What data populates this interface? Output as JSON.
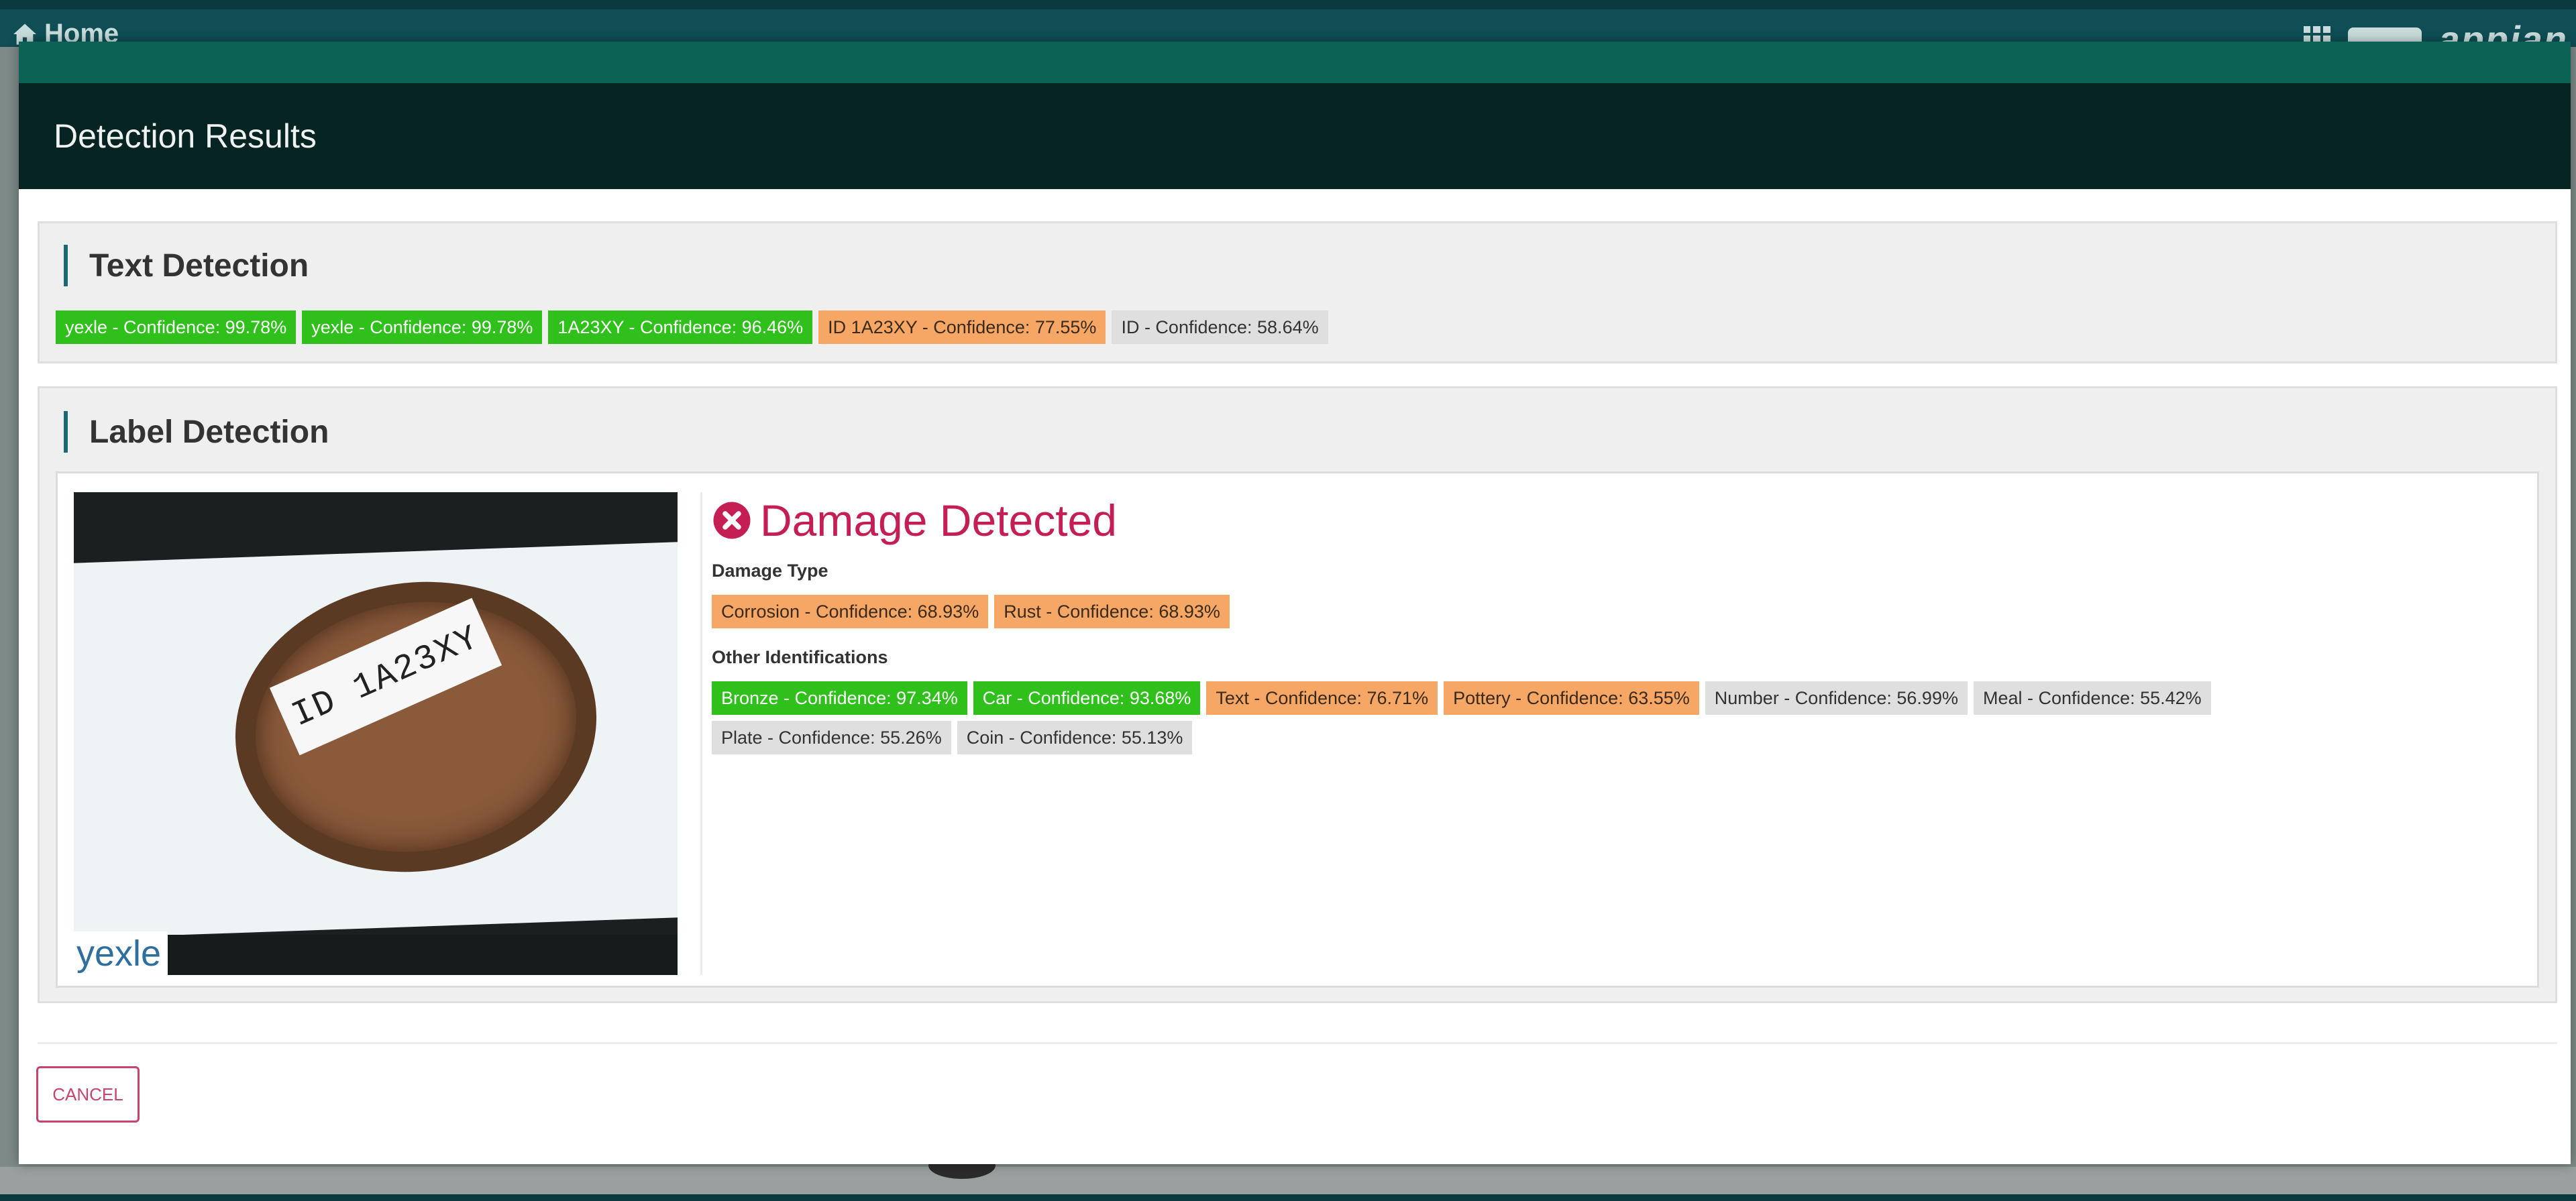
{
  "app": {
    "home_label": "Home",
    "brand": "appian"
  },
  "modal": {
    "title": "Detection Results"
  },
  "text_detection": {
    "heading": "Text Detection",
    "tags": [
      {
        "text": "yexle - Confidence: 99.78%",
        "level": "green"
      },
      {
        "text": "yexle - Confidence: 99.78%",
        "level": "green"
      },
      {
        "text": "1A23XY - Confidence: 96.46%",
        "level": "green"
      },
      {
        "text": "ID 1A23XY - Confidence: 77.55%",
        "level": "orange"
      },
      {
        "text": "ID - Confidence: 58.64%",
        "level": "gray"
      }
    ]
  },
  "label_detection": {
    "heading": "Label Detection",
    "photo": {
      "card_text": "ID 1A23XY",
      "watermark": "yexle"
    },
    "status_title": "Damage Detected",
    "damage_type_label": "Damage Type",
    "damage_tags": [
      {
        "text": "Corrosion - Confidence: 68.93%",
        "level": "orange"
      },
      {
        "text": "Rust - Confidence: 68.93%",
        "level": "orange"
      }
    ],
    "other_label": "Other Identifications",
    "other_tags": [
      {
        "text": "Bronze - Confidence: 97.34%",
        "level": "green"
      },
      {
        "text": "Car - Confidence: 93.68%",
        "level": "green"
      },
      {
        "text": "Text - Confidence: 76.71%",
        "level": "orange"
      },
      {
        "text": "Pottery - Confidence: 63.55%",
        "level": "orange"
      },
      {
        "text": "Number - Confidence: 56.99%",
        "level": "gray"
      },
      {
        "text": "Meal - Confidence: 55.42%",
        "level": "gray"
      },
      {
        "text": "Plate - Confidence: 55.26%",
        "level": "gray"
      },
      {
        "text": "Coin - Confidence: 55.13%",
        "level": "gray"
      }
    ]
  },
  "footer": {
    "cancel_label": "CANCEL"
  },
  "colors": {
    "green": "#2fc01c",
    "orange": "#f7a765",
    "gray": "#dfdfdf",
    "damage": "#c51e54",
    "header": "#062421",
    "accent": "#0b6356"
  },
  "icons": {
    "home": "home-icon",
    "apps": "grid-icon",
    "damage": "x-circle-icon"
  }
}
